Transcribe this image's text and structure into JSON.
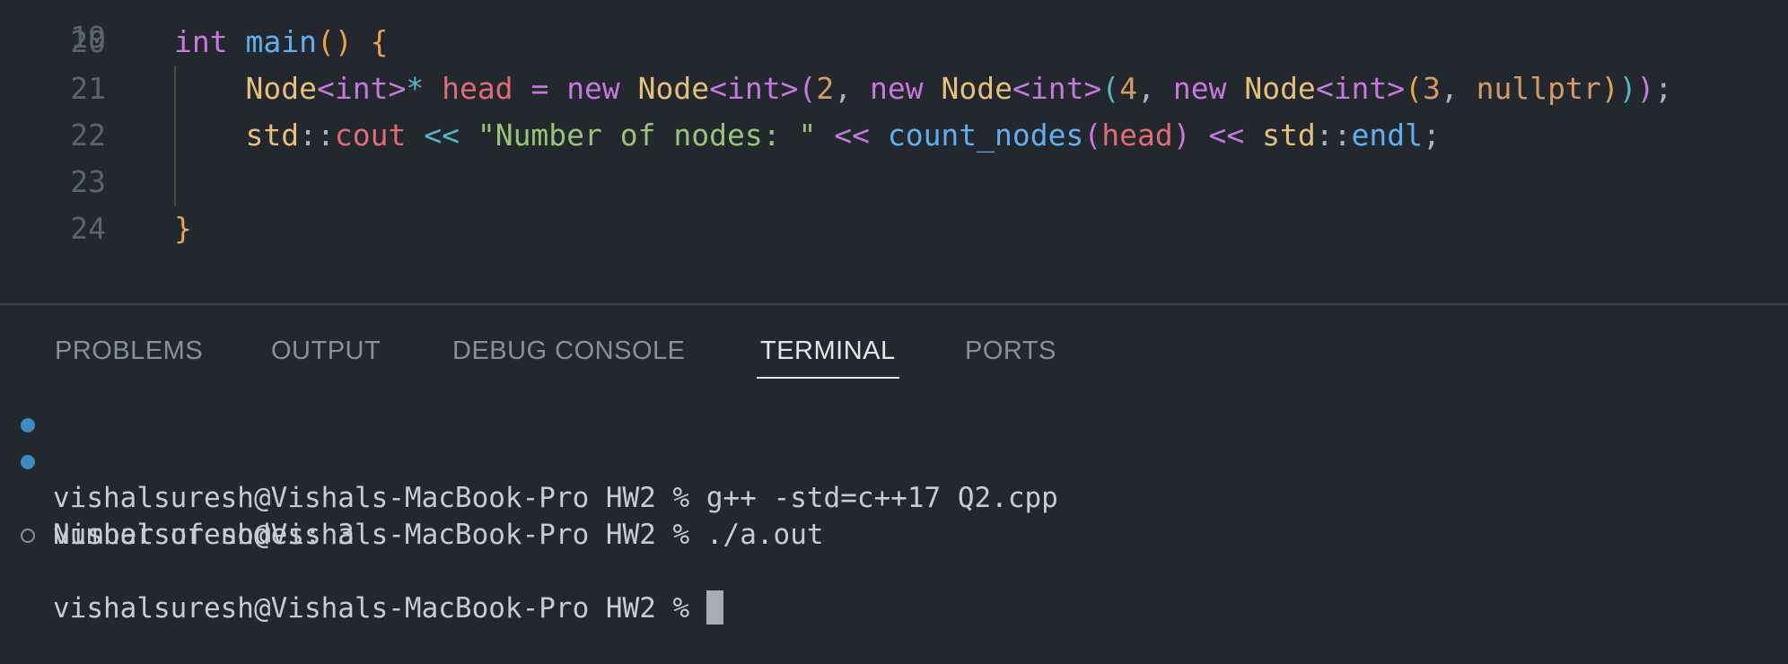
{
  "editor": {
    "partial_line_number": "19",
    "lines": [
      {
        "n": "20",
        "tokens": [
          [
            "int",
            "kw"
          ],
          [
            " ",
            ""
          ],
          [
            "main",
            "fn"
          ],
          [
            "()",
            "br1"
          ],
          [
            " ",
            ""
          ],
          [
            "{",
            "br1"
          ]
        ]
      },
      {
        "n": "21",
        "tokens": [
          [
            "    ",
            ""
          ],
          [
            "Node",
            "ty"
          ],
          [
            "<",
            "br2"
          ],
          [
            "int",
            "kw"
          ],
          [
            ">",
            "br2"
          ],
          [
            "*",
            "op"
          ],
          [
            " ",
            ""
          ],
          [
            "head",
            "vr"
          ],
          [
            " ",
            ""
          ],
          [
            "=",
            "kw"
          ],
          [
            " ",
            ""
          ],
          [
            "new",
            "kw"
          ],
          [
            " ",
            ""
          ],
          [
            "Node",
            "ty"
          ],
          [
            "<",
            "br2"
          ],
          [
            "int",
            "kw"
          ],
          [
            ">",
            "br2"
          ],
          [
            "(",
            "br2"
          ],
          [
            "2",
            "nm"
          ],
          [
            ",",
            "pl"
          ],
          [
            " ",
            ""
          ],
          [
            "new",
            "kw"
          ],
          [
            " ",
            ""
          ],
          [
            "Node",
            "ty"
          ],
          [
            "<",
            "br2"
          ],
          [
            "int",
            "kw"
          ],
          [
            ">",
            "br2"
          ],
          [
            "(",
            "br3"
          ],
          [
            "4",
            "nm"
          ],
          [
            ",",
            "pl"
          ],
          [
            " ",
            ""
          ],
          [
            "new",
            "kw"
          ],
          [
            " ",
            ""
          ],
          [
            "Node",
            "ty"
          ],
          [
            "<",
            "br2"
          ],
          [
            "int",
            "kw"
          ],
          [
            ">",
            "br2"
          ],
          [
            "(",
            "br1"
          ],
          [
            "3",
            "nm"
          ],
          [
            ",",
            "pl"
          ],
          [
            " ",
            ""
          ],
          [
            "nullptr",
            "nm"
          ],
          [
            ")",
            "br1"
          ],
          [
            ")",
            "br3"
          ],
          [
            ")",
            "br2"
          ],
          [
            ";",
            "pl"
          ]
        ]
      },
      {
        "n": "22",
        "tokens": [
          [
            "    ",
            ""
          ],
          [
            "std",
            "ty"
          ],
          [
            "::",
            "pl"
          ],
          [
            "cout",
            "vr"
          ],
          [
            " ",
            ""
          ],
          [
            "<<",
            "op"
          ],
          [
            " ",
            ""
          ],
          [
            "\"Number of nodes: \"",
            "st"
          ],
          [
            " ",
            ""
          ],
          [
            "<<",
            "kw"
          ],
          [
            " ",
            ""
          ],
          [
            "count_nodes",
            "fn"
          ],
          [
            "(",
            "br2"
          ],
          [
            "head",
            "vr"
          ],
          [
            ")",
            "br2"
          ],
          [
            " ",
            ""
          ],
          [
            "<<",
            "kw"
          ],
          [
            " ",
            ""
          ],
          [
            "std",
            "ty"
          ],
          [
            "::",
            "pl"
          ],
          [
            "endl",
            "fn"
          ],
          [
            ";",
            "pl"
          ]
        ]
      },
      {
        "n": "23",
        "tokens": []
      },
      {
        "n": "24",
        "tokens": [
          [
            "}",
            "br1"
          ]
        ]
      }
    ]
  },
  "panel": {
    "tabs": [
      {
        "label": "PROBLEMS",
        "active": false
      },
      {
        "label": "OUTPUT",
        "active": false
      },
      {
        "label": "DEBUG CONSOLE",
        "active": false
      },
      {
        "label": "TERMINAL",
        "active": true
      },
      {
        "label": "PORTS",
        "active": false
      }
    ]
  },
  "terminal": {
    "lines": [
      {
        "marker": "filled",
        "text": "vishalsuresh@Vishals-MacBook-Pro HW2 % g++ -std=c++17 Q2.cpp"
      },
      {
        "marker": "filled",
        "text": "vishalsuresh@Vishals-MacBook-Pro HW2 % ./a.out"
      },
      {
        "marker": "none",
        "text": "Number of nodes: 3"
      },
      {
        "marker": "hollow",
        "text": "vishalsuresh@Vishals-MacBook-Pro HW2 % "
      }
    ]
  }
}
